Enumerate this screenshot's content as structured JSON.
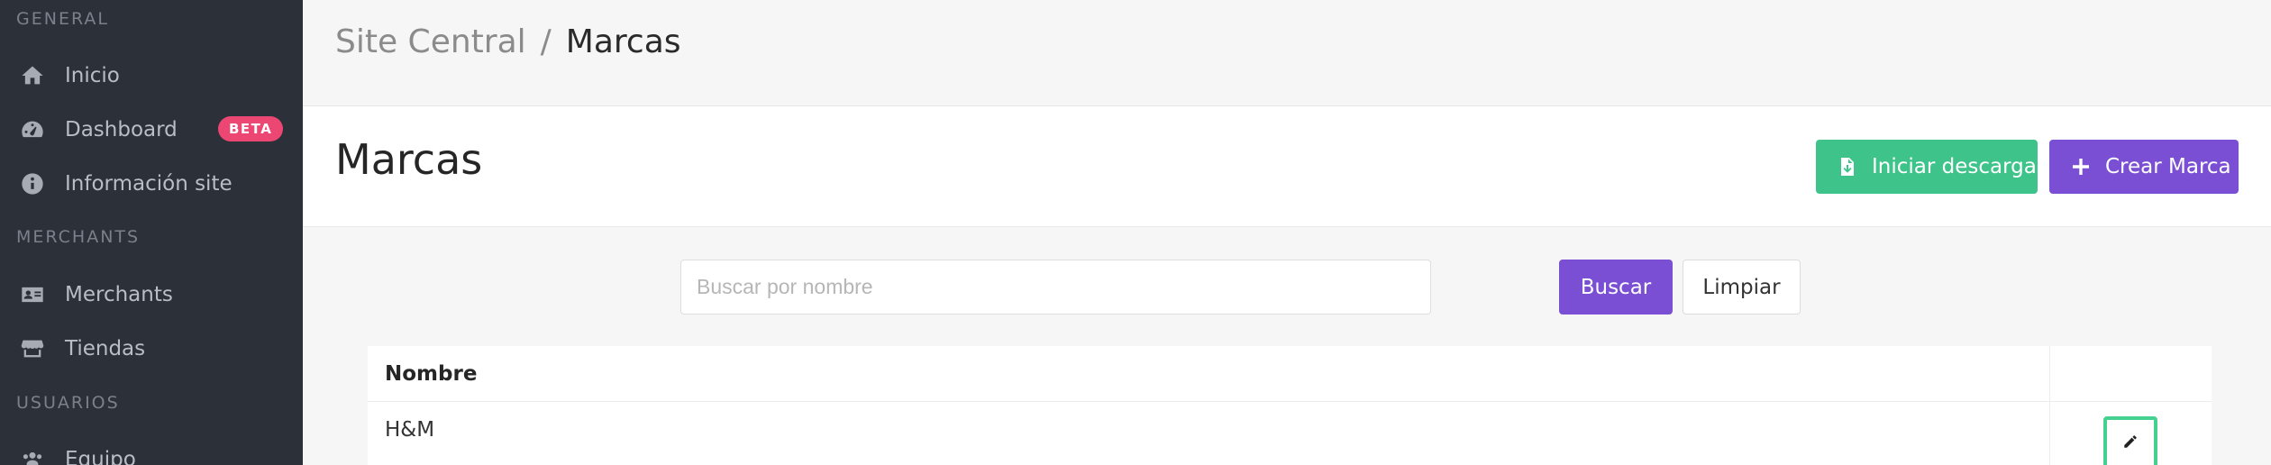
{
  "sidebar": {
    "sections": {
      "general": "GENERAL",
      "merchants": "MERCHANTS",
      "usuarios": "USUARIOS"
    },
    "items": [
      {
        "label": "Inicio",
        "icon": "home-icon"
      },
      {
        "label": "Dashboard",
        "icon": "dashboard-icon",
        "badge": "BETA"
      },
      {
        "label": "Información site",
        "icon": "info-icon"
      },
      {
        "label": "Merchants",
        "icon": "id-card-icon"
      },
      {
        "label": "Tiendas",
        "icon": "store-icon"
      },
      {
        "label": "Equipo",
        "icon": "users-icon"
      }
    ]
  },
  "header": {
    "breadcrumb": {
      "parent": "Site Central",
      "separator": "/",
      "current": "Marcas"
    }
  },
  "titlebar": {
    "title": "Marcas",
    "download_label": "Iniciar descarga",
    "create_label": "Crear Marca"
  },
  "search": {
    "placeholder": "Buscar por nombre",
    "value": "",
    "search_label": "Buscar",
    "clear_label": "Limpiar"
  },
  "table": {
    "columns": [
      "Nombre",
      ""
    ],
    "rows": [
      {
        "name": "H&M"
      }
    ]
  },
  "colors": {
    "sidebar_bg": "#2c3039",
    "accent_purple": "#7a4fd3",
    "accent_green": "#3ec48a",
    "badge_pink": "#ec4672",
    "focus_ring": "#45d18f"
  }
}
